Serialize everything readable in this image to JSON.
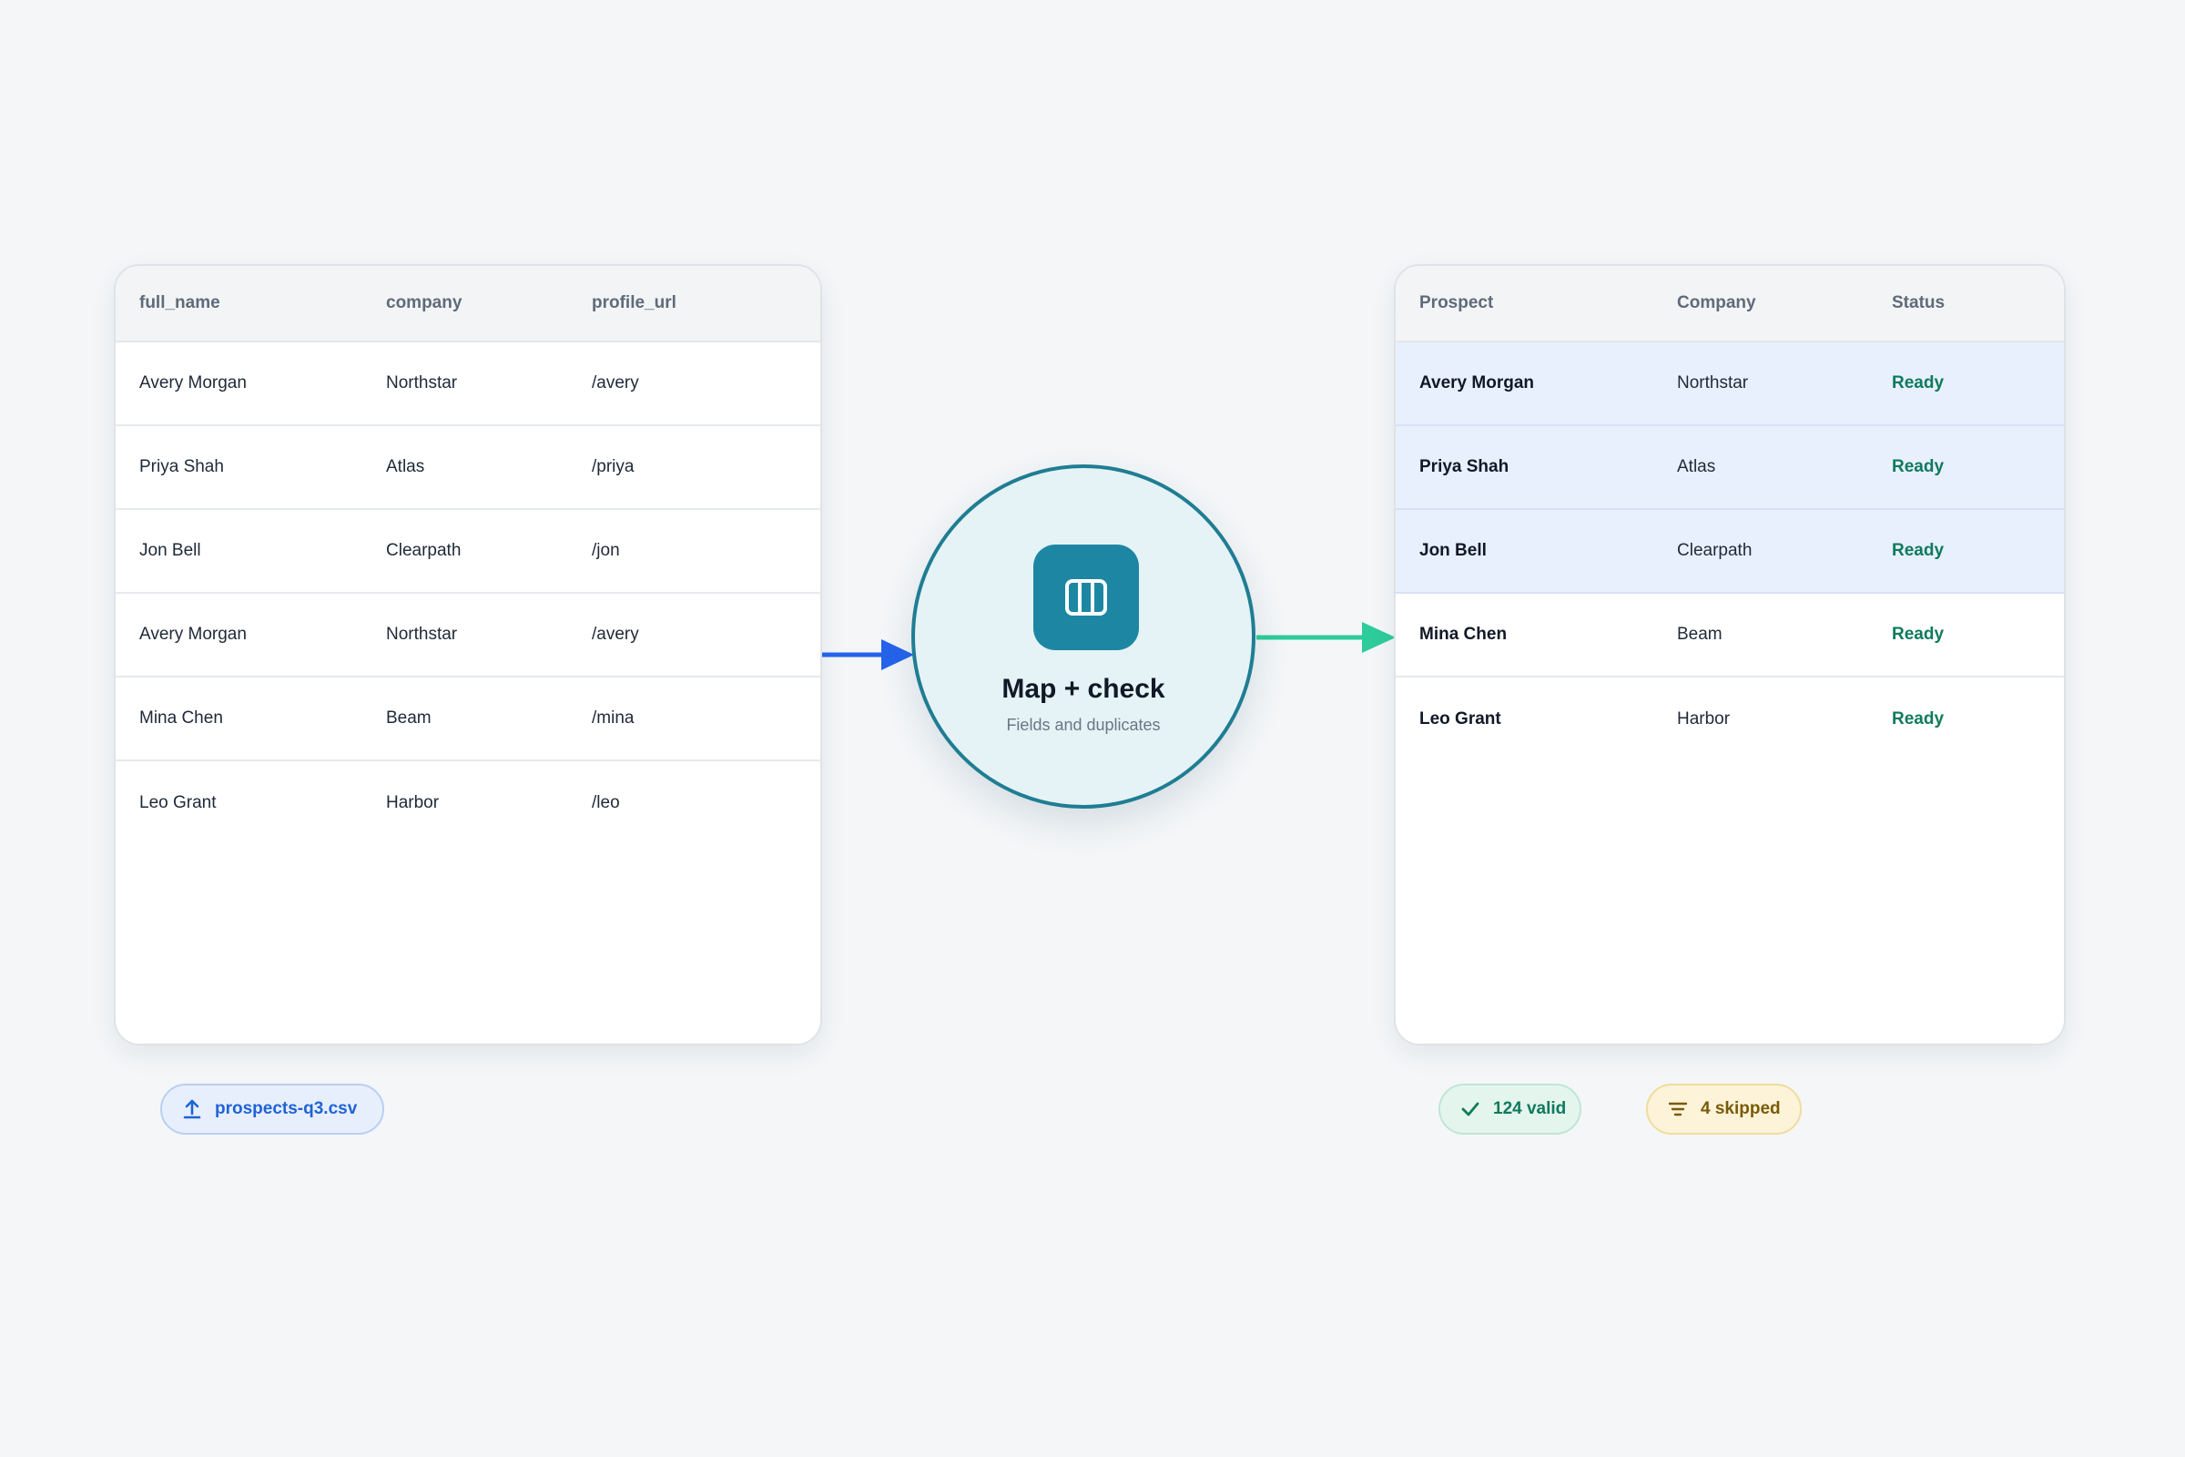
{
  "source_table": {
    "columns": [
      "full_name",
      "company",
      "profile_url"
    ],
    "rows": [
      [
        "Avery Morgan",
        "Northstar",
        "/avery"
      ],
      [
        "Priya Shah",
        "Atlas",
        "/priya"
      ],
      [
        "Jon Bell",
        "Clearpath",
        "/jon"
      ],
      [
        "Avery Morgan",
        "Northstar",
        "/avery"
      ],
      [
        "Mina Chen",
        "Beam",
        "/mina"
      ],
      [
        "Leo Grant",
        "Harbor",
        "/leo"
      ]
    ]
  },
  "process_node": {
    "title": "Map + check",
    "subtitle": "Fields and duplicates",
    "icon": "columns-icon"
  },
  "output_table": {
    "columns": [
      "Prospect",
      "Company",
      "Status"
    ],
    "rows": [
      [
        "Avery Morgan",
        "Northstar",
        "Ready"
      ],
      [
        "Priya Shah",
        "Atlas",
        "Ready"
      ],
      [
        "Jon Bell",
        "Clearpath",
        "Ready"
      ],
      [
        "Mina Chen",
        "Beam",
        "Ready"
      ],
      [
        "Leo Grant",
        "Harbor",
        "Ready"
      ]
    ]
  },
  "badges": {
    "file": {
      "label": "prospects-q3.csv",
      "icon": "upload-icon"
    },
    "valid": {
      "label": "124 valid",
      "icon": "check-icon"
    },
    "skipped": {
      "label": "4 skipped",
      "icon": "filter-icon"
    }
  },
  "colors": {
    "input_arrow": "#2563eb",
    "output_arrow": "#2ecc9a",
    "hub_border": "#1f7d93",
    "hub_icon_bg": "#1d87a3",
    "ready": "#0f7a5c"
  }
}
